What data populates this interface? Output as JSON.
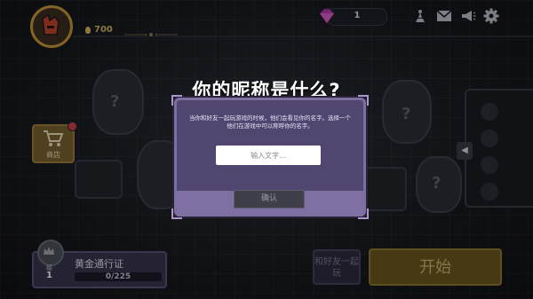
{
  "header": {
    "gold": "700",
    "gems": "1"
  },
  "shop": {
    "label": "商店"
  },
  "pass": {
    "title": "黄金通行证",
    "progress": "0/225",
    "level_label": "级",
    "level": "1"
  },
  "buttons": {
    "play_with_friend": "和好友一起玩",
    "start": "开始"
  },
  "dialog": {
    "title": "你的昵称是什么?",
    "message": "当你和好友一起玩游戏的时候，他们会看见你的名字。选择一个他们在游戏中可以称呼你的名字。",
    "input_placeholder": "输入文字...",
    "confirm": "确认"
  },
  "colors": {
    "dialog_bg": "#514670",
    "dialog_border": "#7d6fa0",
    "start_button": "#6b5a1f",
    "gold_text": "#d8b860"
  }
}
